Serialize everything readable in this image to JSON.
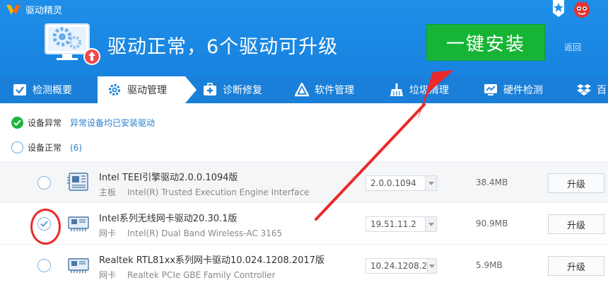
{
  "app": {
    "title": "驱动精灵"
  },
  "header": {
    "headline": "驱动正常，6个驱动可升级",
    "install_label": "一键安装",
    "back_label": "返回"
  },
  "tabs": [
    {
      "label": "检测概要",
      "icon": "monitor-check-icon"
    },
    {
      "label": "驱动管理",
      "icon": "gear-icon",
      "active": true
    },
    {
      "label": "诊断修复",
      "icon": "medical-kit-icon"
    },
    {
      "label": "软件管理",
      "icon": "triangle-logo-icon"
    },
    {
      "label": "垃圾清理",
      "icon": "broom-icon"
    },
    {
      "label": "硬件检测",
      "icon": "chart-monitor-icon"
    },
    {
      "label": "百",
      "icon": "dropbox-box-icon"
    }
  ],
  "status": {
    "abnormal_label": "设备异常",
    "abnormal_desc": "异常设备均已安装驱动",
    "normal_label": "设备正常",
    "normal_count": "(6)"
  },
  "drivers": [
    {
      "title": "Intel TEEI引擎驱动2.0.0.1094版",
      "category": "主板",
      "device": "Intel(R) Trusted Execution Engine Interface",
      "version": "2.0.0.1094",
      "size": "38.4MB",
      "action": "升级",
      "checked": false
    },
    {
      "title": "Intel系列无线网卡驱动20.30.1版",
      "category": "网卡",
      "device": "Intel(R) Dual Band Wireless-AC 3165",
      "version": "19.51.11.2",
      "size": "90.9MB",
      "action": "升级",
      "checked": true
    },
    {
      "title": "Realtek RTL81xx系列网卡驱动10.024.1208.2017版",
      "category": "网卡",
      "device": "Realtek PCIe GBE Family Controller",
      "version": "10.24.1208.2",
      "size": "5.9MB",
      "action": "升级",
      "checked": false
    }
  ],
  "colors": {
    "header_blue": "#1e8fe8",
    "tab_blue": "#1a7fd8",
    "install_green": "#17b535",
    "annotation_red": "#ea2a2a"
  }
}
